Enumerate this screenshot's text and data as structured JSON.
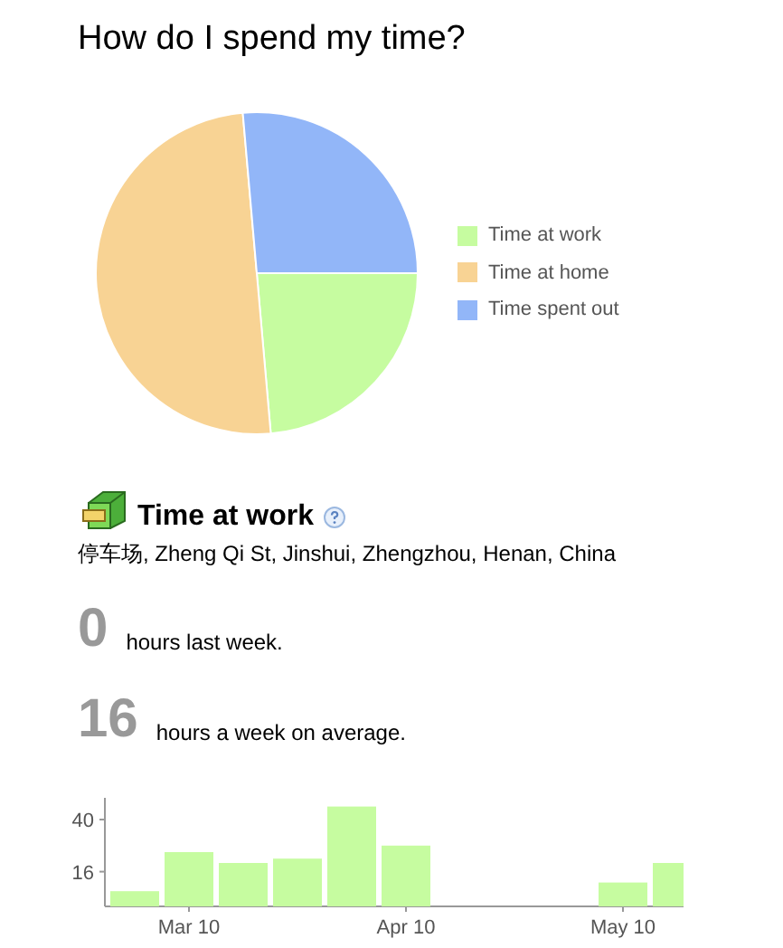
{
  "title": "How do I spend my time?",
  "legend": [
    {
      "label": "Time at work",
      "color": "#c6fca0"
    },
    {
      "label": "Time at home",
      "color": "#f8d394"
    },
    {
      "label": "Time spent out",
      "color": "#92b6f8"
    }
  ],
  "section": {
    "title": "Time at work",
    "address": "停车场, Zheng Qi St, Jinshui, Zhengzhou, Henan, China"
  },
  "stats": [
    {
      "value": "0",
      "label": "hours last week."
    },
    {
      "value": "16",
      "label": "hours a week on average."
    }
  ],
  "chart_data": {
    "type": "bar",
    "categories": [
      null,
      "Mar 10",
      null,
      null,
      null,
      "Apr 10",
      null,
      null,
      null,
      "May 10",
      null
    ],
    "series": [
      {
        "color": "#c6fca0",
        "values": [
          7,
          25,
          20,
          22,
          46,
          28,
          null,
          null,
          null,
          11,
          20
        ]
      }
    ],
    "ylim": [
      0,
      50
    ],
    "yticks": [
      16,
      40
    ]
  }
}
